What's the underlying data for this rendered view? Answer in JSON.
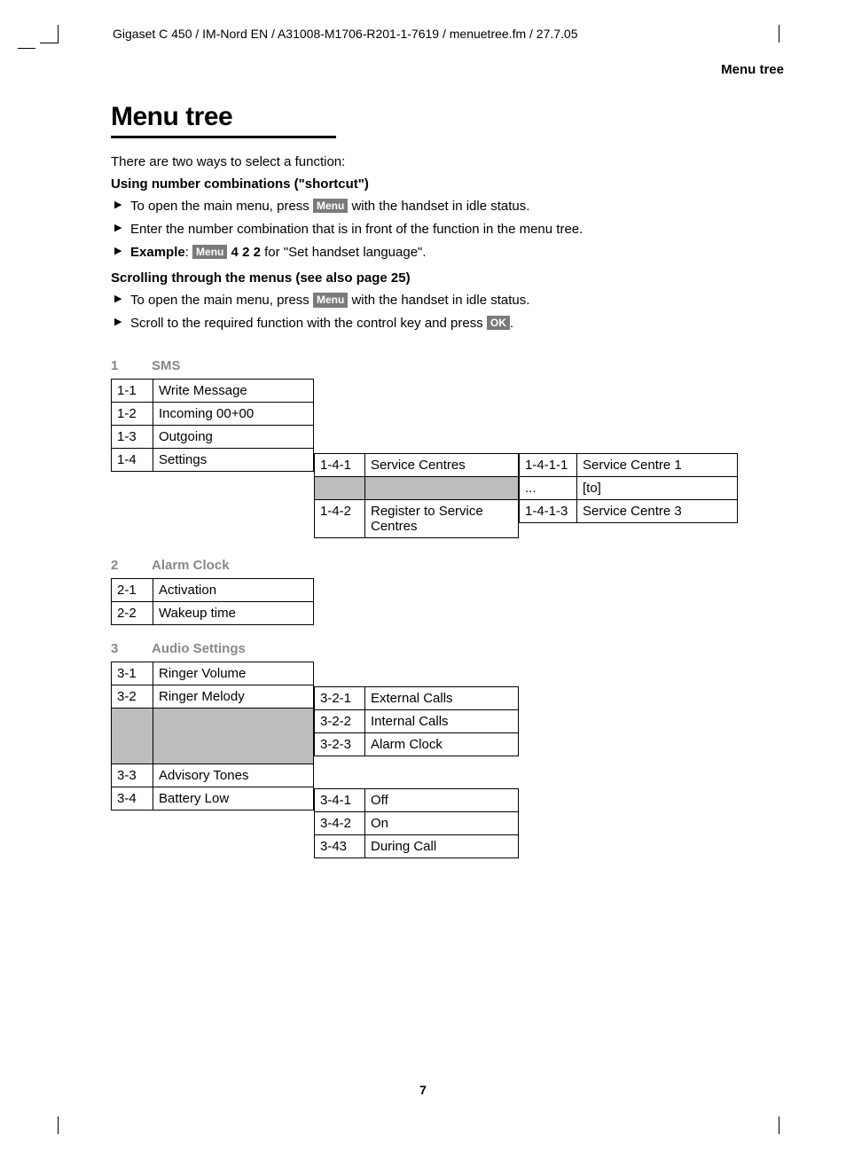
{
  "header": "Gigaset C 450 / IM-Nord EN / A31008-M1706-R201-1-7619 / menuetree.fm / 27.7.05",
  "section_label": "Menu tree",
  "title": "Menu tree",
  "intro": "There are two ways to select a function:",
  "sub1": "Using number combinations (\"shortcut\")",
  "b1": {
    "a_pre": "To open the main menu, press ",
    "a_key": "Menu",
    "a_post": " with the handset in idle status.",
    "b": "Enter the number combination that is in front of the function in the menu tree.",
    "c_label": "Example",
    "c_key": "Menu",
    "c_seq": "  4 2 2",
    "c_post": " for \"Set handset language\"."
  },
  "sub2": "Scrolling through the menus (see also page 25)",
  "b2": {
    "a_pre": "To open the main menu, press ",
    "a_key": "Menu",
    "a_post": " with the handset in idle status.",
    "b_pre": "Scroll to the required function with the control key and press ",
    "b_key": "OK",
    "b_post": "."
  },
  "s1": {
    "num": "1",
    "title": "SMS",
    "l1": [
      {
        "c": "1-1",
        "t": "Write Message"
      },
      {
        "c": "1-2",
        "t": "Incoming  00+00"
      },
      {
        "c": "1-3",
        "t": "Outgoing"
      },
      {
        "c": "1-4",
        "t": "Settings"
      }
    ],
    "l2": [
      {
        "c": "1-4-1",
        "t": "Service Centres"
      },
      {
        "c": "",
        "t": "",
        "grey": true
      },
      {
        "c": "1-4-2",
        "t": "Register to Service Centres"
      }
    ],
    "l3": [
      {
        "c": "1-4-1-1",
        "t": "Service  Centre 1"
      },
      {
        "c": "...",
        "t": "[to]"
      },
      {
        "c": "1-4-1-3",
        "t": "Service  Centre 3"
      }
    ]
  },
  "s2": {
    "num": "2",
    "title": "Alarm Clock",
    "l1": [
      {
        "c": "2-1",
        "t": "Activation"
      },
      {
        "c": "2-2",
        "t": "Wakeup time"
      }
    ]
  },
  "s3": {
    "num": "3",
    "title": "Audio Settings",
    "l1": [
      {
        "c": "3-1",
        "t": "Ringer  Volume"
      },
      {
        "c": "3-2",
        "t": "Ringer  Melody"
      },
      {
        "c": "",
        "t": "",
        "grey": true
      },
      {
        "c": "3-3",
        "t": "Advisory Tones"
      },
      {
        "c": "3-4",
        "t": "Battery Low"
      }
    ],
    "l2a": [
      {
        "c": "3-2-1",
        "t": "External Calls"
      },
      {
        "c": "3-2-2",
        "t": "Internal Calls"
      },
      {
        "c": "3-2-3",
        "t": "Alarm Clock"
      }
    ],
    "l2b": [
      {
        "c": "3-4-1",
        "t": "Off"
      },
      {
        "c": "3-4-2",
        "t": "On"
      },
      {
        "c": "3-43",
        "t": "During Call"
      }
    ]
  },
  "page_number": "7"
}
